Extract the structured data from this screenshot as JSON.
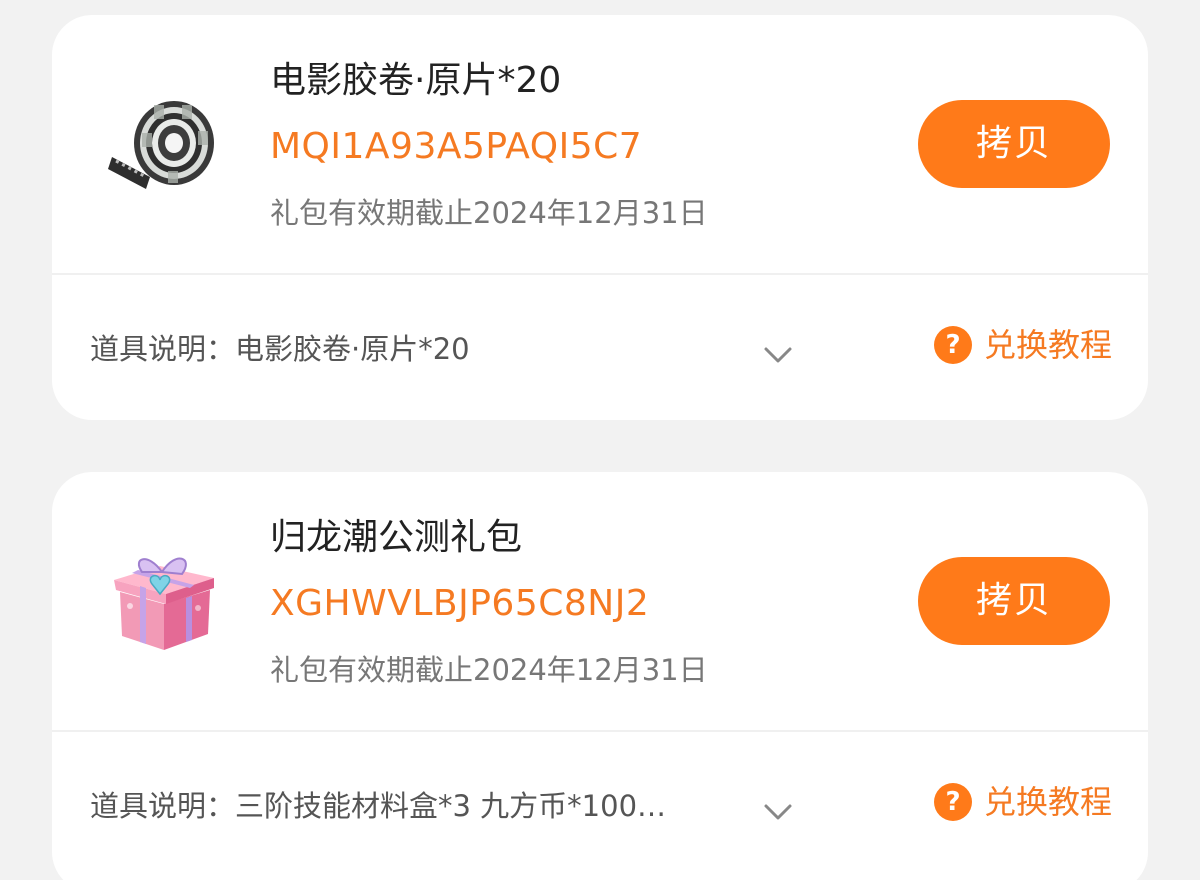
{
  "gifts": [
    {
      "title": "电影胶卷·原片*20",
      "code": "MQI1A93A5PAQI5C7",
      "expiry": "礼包有效期截止2024年12月31日",
      "copy_label": "拷贝",
      "description": "道具说明：电影胶卷·原片*20",
      "tutorial_label": "兑换教程",
      "icon": "film-reel-icon"
    },
    {
      "title": "归龙潮公测礼包",
      "code": "XGHWVLBJP65C8NJ2",
      "expiry": "礼包有效期截止2024年12月31日",
      "copy_label": "拷贝",
      "description": "道具说明：三阶技能材料盒*3 九方币*100…",
      "tutorial_label": "兑换教程",
      "icon": "gift-box-icon"
    }
  ],
  "help_glyph": "?",
  "colors": {
    "accent": "#ff7a19",
    "code_text": "#f57a22",
    "background": "#f2f2f2",
    "card": "#ffffff"
  }
}
